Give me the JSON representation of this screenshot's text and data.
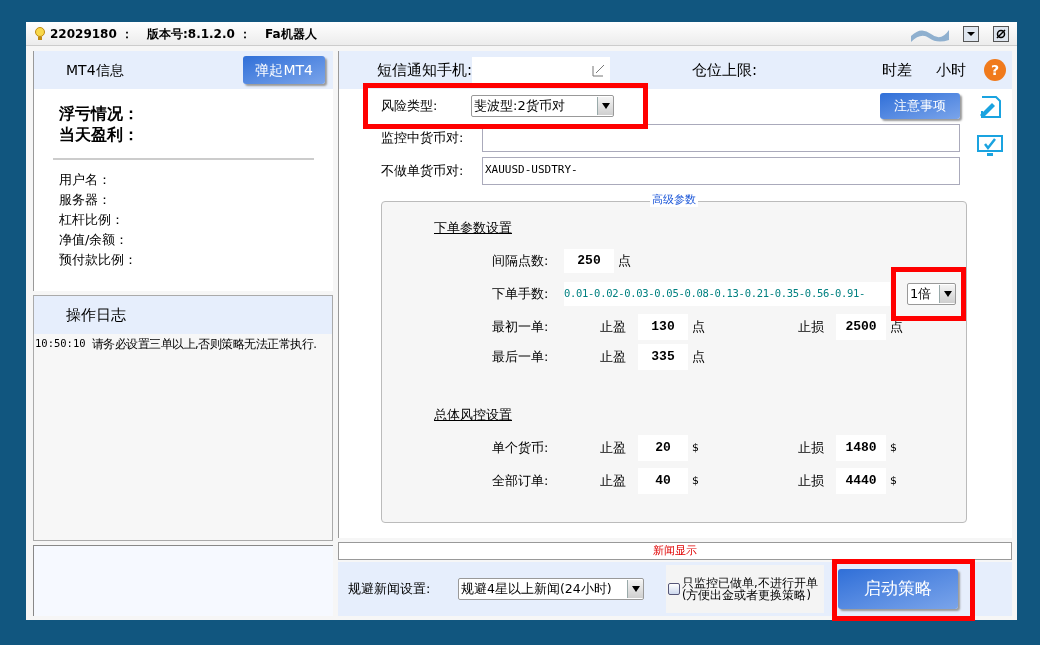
{
  "title_bar": {
    "account": "22029180 ：",
    "version": "版本号:8.1.2.0 ：",
    "app": "Fa机器人"
  },
  "left": {
    "mt4": {
      "title": "MT4信息",
      "button": "弹起MT4"
    },
    "summary": [
      "浮亏情况：",
      "当天盈利："
    ],
    "fields": [
      "用户名：",
      "服务器：",
      "杠杆比例：",
      "净值/余额：",
      "预付款比例："
    ],
    "log": {
      "title": "操作日志",
      "entries": [
        {
          "time": "10:50:10",
          "text": "请务必设置三单以上,否则策略无法正常执行."
        }
      ]
    }
  },
  "top_bar": {
    "sms_label": "短信通知手机:",
    "position_limit": "仓位上限:",
    "time_diff": "时差",
    "hours": "小时",
    "help": "?"
  },
  "form": {
    "risk_type": {
      "label": "风险类型:",
      "value": "斐波型:2货币对",
      "highlighted": true
    },
    "notice_button": "注意事项",
    "monitored": {
      "label": "监控中货币对:"
    },
    "excluded": {
      "label": "不做单货币对:",
      "value": "XAUUSD-USDTRY-"
    }
  },
  "advanced": {
    "title": "高级参数",
    "order_section": {
      "heading": "下单参数设置",
      "interval": {
        "label": "间隔点数:",
        "value": "250",
        "unit": "点"
      },
      "lots": {
        "label": "下单手数:",
        "value": "0.01-0.02-0.03-0.05-0.08-0.13-0.21-0.35-0.56-0.91-",
        "multiplier": "1倍",
        "highlighted": true
      },
      "rows": [
        {
          "label": "最初一单:",
          "tp_label": "止盈",
          "tp": "130",
          "tp_unit": "点",
          "sl_label": "止损",
          "sl": "2500",
          "sl_unit": "点"
        },
        {
          "label": "最后一单:",
          "tp_label": "止盈",
          "tp": "335",
          "tp_unit": "点"
        }
      ]
    },
    "risk_section": {
      "heading": "总体风控设置",
      "rows": [
        {
          "label": "单个货币:",
          "tp_label": "止盈",
          "tp": "20",
          "tp_unit": "$",
          "sl_label": "止损",
          "sl": "1480",
          "sl_unit": "$"
        },
        {
          "label": "全部订单:",
          "tp_label": "止盈",
          "tp": "40",
          "tp_unit": "$",
          "sl_label": "止损",
          "sl": "4440",
          "sl_unit": "$"
        }
      ]
    }
  },
  "news": {
    "title": "新闻显示",
    "avoid_label": "规避新闻设置:",
    "avoid_value": "规避4星以上新闻(24小时)",
    "monitor_only": {
      "lines": [
        "只监控已做单,不进行开单",
        "(方便出金或者更换策略)"
      ],
      "checked": false
    },
    "start_button": {
      "label": "启动策略",
      "highlighted": true
    }
  }
}
